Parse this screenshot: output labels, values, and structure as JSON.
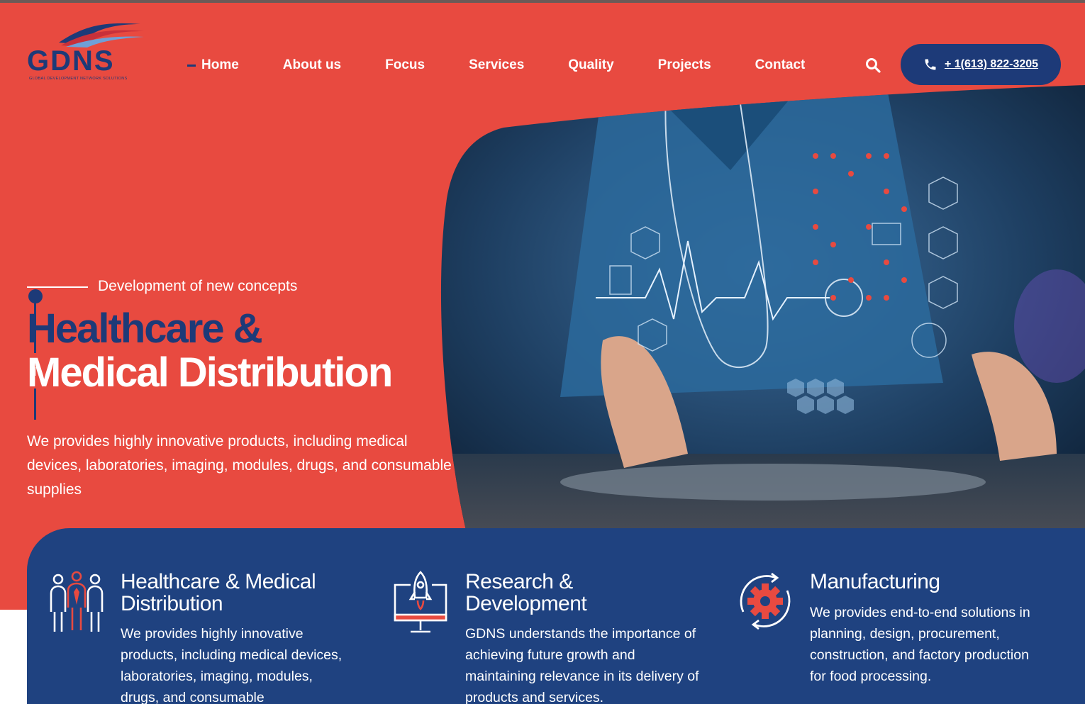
{
  "brand": {
    "name": "GDNS",
    "tagline": "GLOBAL DEVELOPMENT NETWORK SOLUTIONS",
    "primary": "#e84a40",
    "secondary": "#1d3a78"
  },
  "nav": {
    "items": [
      {
        "label": "Home",
        "active": true
      },
      {
        "label": "About us"
      },
      {
        "label": "Focus"
      },
      {
        "label": "Services"
      },
      {
        "label": "Quality"
      },
      {
        "label": "Projects"
      },
      {
        "label": "Contact"
      }
    ],
    "search_icon": "search-icon",
    "phone": "+ 1(613) 822-3205"
  },
  "hero": {
    "eyebrow": "Development of new concepts",
    "title_line1": "Healthcare &",
    "title_line2": "Medical Distribution",
    "description": "We provides highly innovative products, including medical devices, laboratories, imaging, modules, drugs, and consumable supplies",
    "image_alt": "doctor-tablet-medical-hud"
  },
  "services": [
    {
      "icon": "people-icon",
      "title": "Healthcare & Medical Distribution",
      "text": "We provides highly innovative products, including medical devices, laboratories, imaging, modules, drugs, and consumable"
    },
    {
      "icon": "rocket-monitor-icon",
      "title": "Research & Development",
      "text": "GDNS understands the importance of achieving future growth and maintaining relevance in its delivery of products and services."
    },
    {
      "icon": "gear-cycle-icon",
      "title": "Manufacturing",
      "text": "We provides end-to-end solutions in planning, design, procurement, construction, and factory production for food processing."
    }
  ]
}
